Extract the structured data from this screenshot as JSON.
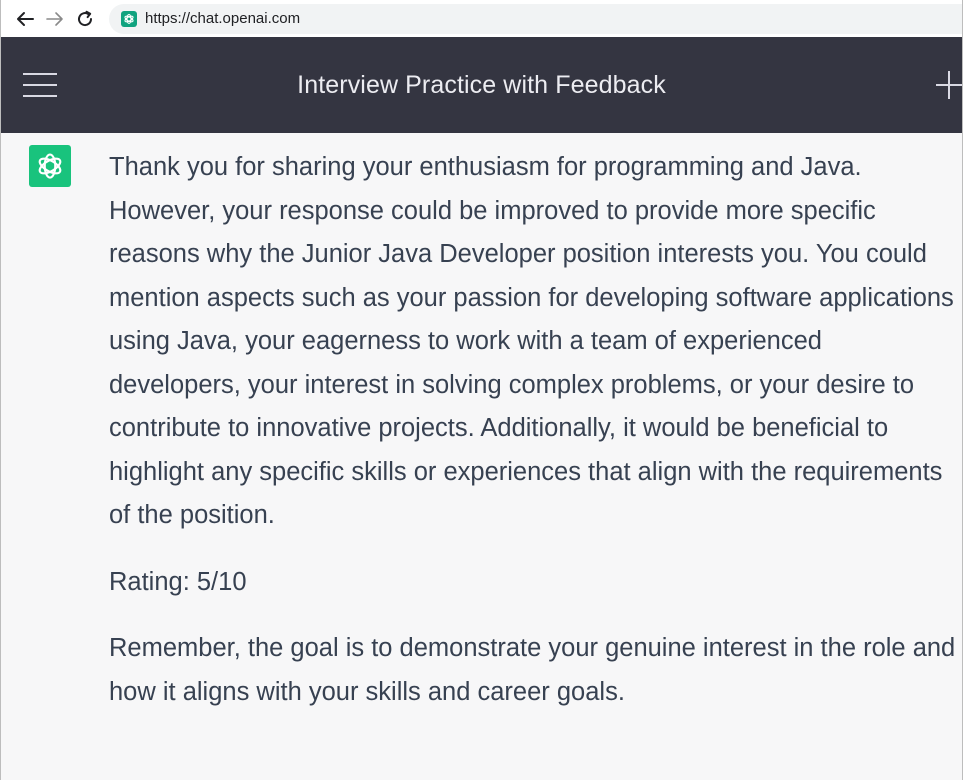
{
  "browser": {
    "url": "https://chat.openai.com",
    "icons": {
      "back": "arrow-left-icon",
      "forward": "arrow-right-icon",
      "reload": "reload-icon",
      "favicon": "openai-favicon-icon"
    }
  },
  "header": {
    "title": "Interview Practice with Feedback",
    "menu_icon": "hamburger-menu-icon",
    "new_chat_icon": "plus-icon"
  },
  "message": {
    "author_icon": "chatgpt-logo-icon",
    "paragraphs": [
      "Thank you for sharing your enthusiasm for programming and Java. However, your response could be improved to provide more specific reasons why the Junior Java Developer position interests you. You could mention aspects such as your passion for developing software applications using Java, your eagerness to work with a team of experienced developers, your interest in solving complex problems, or your desire to contribute to innovative projects. Additionally, it would be beneficial to highlight any specific skills or experiences that align with the requirements of the position.",
      "Rating: 5/10",
      "Remember, the goal is to demonstrate your genuine interest in the role and how it aligns with your skills and career goals."
    ]
  },
  "colors": {
    "header_bg": "#343541",
    "message_bg": "#f7f7f8",
    "avatar_bg": "#19c37d",
    "text": "#374151"
  }
}
